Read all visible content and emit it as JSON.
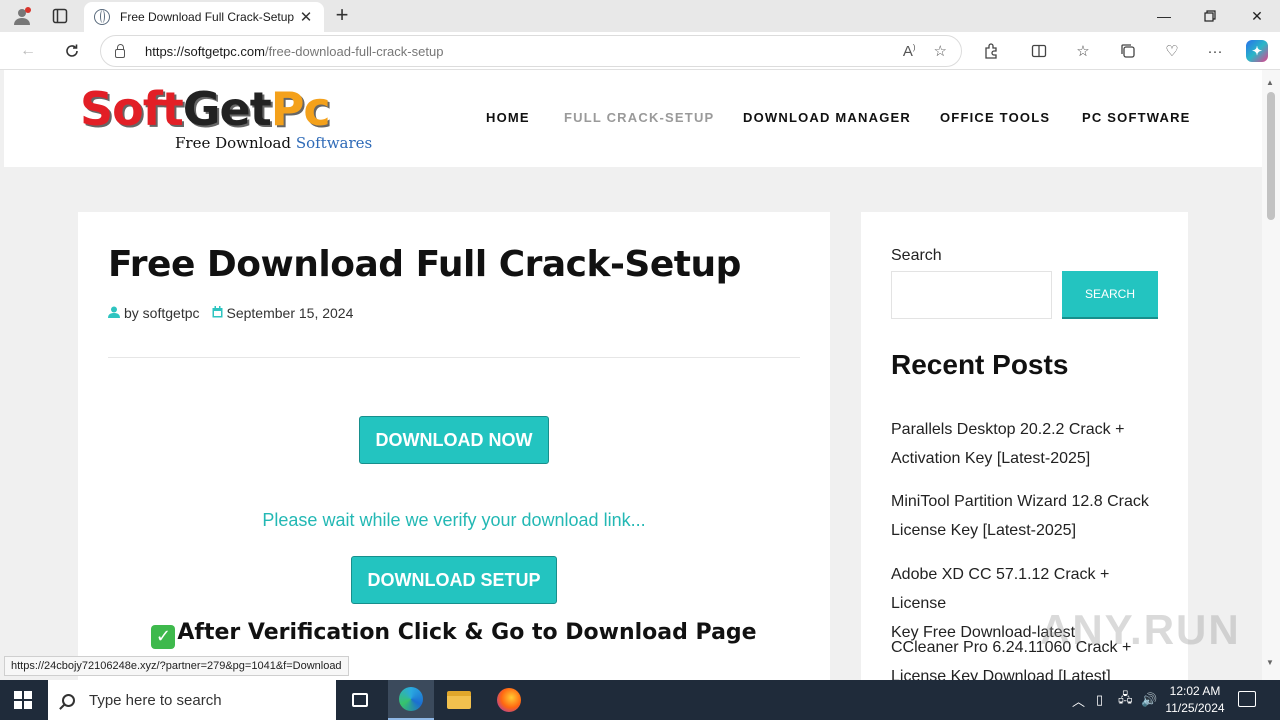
{
  "browser": {
    "tab_title": "Free Download Full Crack-Setup",
    "url_host": "https://softgetpc.com",
    "url_path": "/free-download-full-crack-setup",
    "status_link": "https://24cbojy72106248e.xyz/?partner=279&pg=1041&f=Download"
  },
  "site": {
    "logo": {
      "part1": "Soft",
      "part2": "Get",
      "part3": "Pc",
      "tagline_a": "Free Download",
      "tagline_b": "Softwares"
    },
    "menu": [
      {
        "label": "HOME"
      },
      {
        "label": "FULL CRACK-SETUP"
      },
      {
        "label": "DOWNLOAD MANAGER"
      },
      {
        "label": "OFFICE TOOLS"
      },
      {
        "label": "PC SOFTWARE"
      }
    ]
  },
  "post": {
    "title": "Free Download Full Crack-Setup",
    "author": "by softgetpc",
    "date": "September 15, 2024",
    "download_now": "DOWNLOAD NOW",
    "wait_message": "Please wait while we verify your download link...",
    "download_setup": "DOWNLOAD SETUP",
    "after_verification": "After Verification Click & Go to Download Page"
  },
  "sidebar": {
    "search_label": "Search",
    "search_button": "SEARCH",
    "search_placeholder": "",
    "recent_title": "Recent Posts",
    "recent_posts": [
      {
        "line1": "Parallels Desktop 20.2.2 Crack +",
        "line2": "Activation Key [Latest-2025]"
      },
      {
        "line1": "MiniTool Partition Wizard 12.8 Crack",
        "line2": "License Key [Latest-2025]"
      },
      {
        "line1": "Adobe XD CC 57.1.12 Crack + License",
        "line2": "Key Free Download-latest"
      },
      {
        "line1": "CCleaner Pro 6.24.11060 Crack +",
        "line2": "License Key Download [Latest]"
      }
    ]
  },
  "watermark": "ANY.RUN",
  "taskbar": {
    "search_placeholder": "Type here to search",
    "time": "12:02 AM",
    "date": "11/25/2024"
  },
  "colors": {
    "accent": "#23c4c0",
    "logo_red": "#e21f26",
    "logo_orange": "#f4a11b",
    "taskbar": "#1f2b3a"
  }
}
